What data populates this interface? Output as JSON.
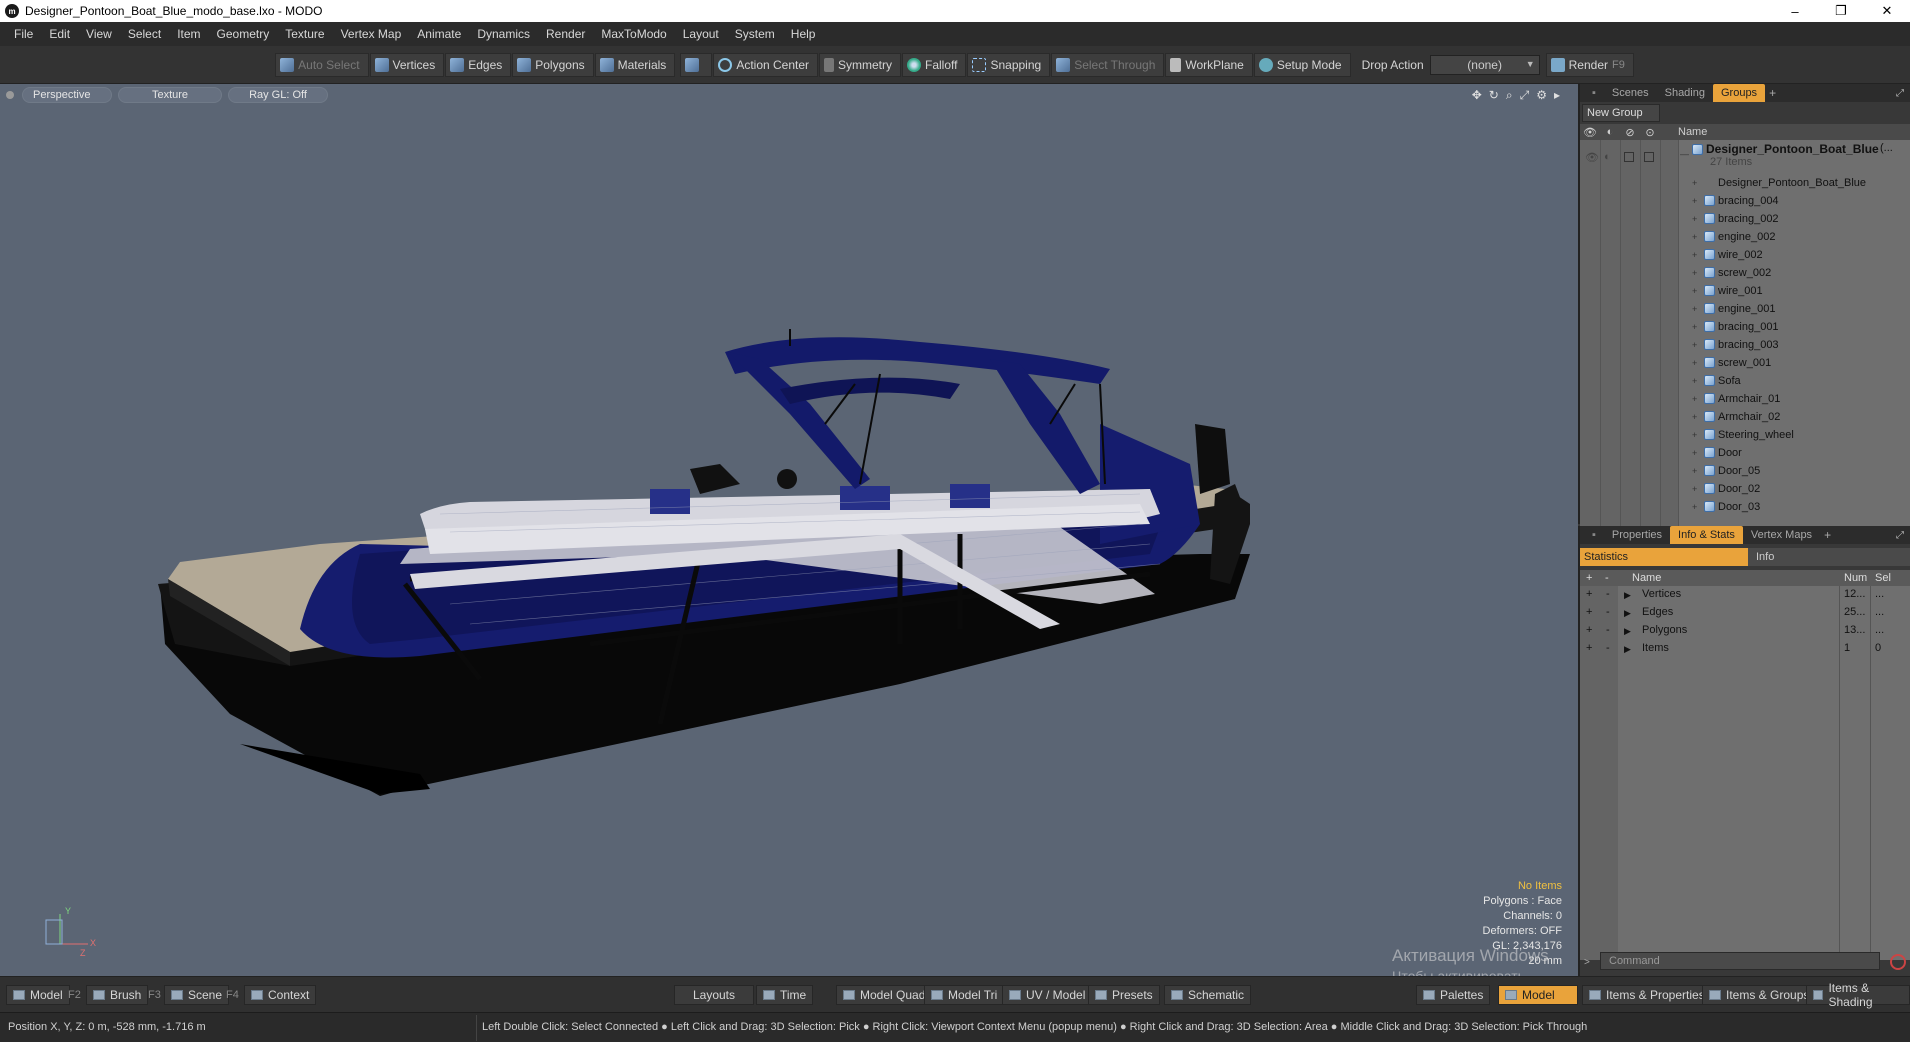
{
  "window": {
    "title": "Designer_Pontoon_Boat_Blue_modo_base.lxo - MODO",
    "controls": [
      "–",
      "❐",
      "✕"
    ]
  },
  "menu": [
    "File",
    "Edit",
    "View",
    "Select",
    "Item",
    "Geometry",
    "Texture",
    "Vertex Map",
    "Animate",
    "Dynamics",
    "Render",
    "MaxToModo",
    "Layout",
    "System",
    "Help"
  ],
  "toolbar": {
    "auto_select": "Auto Select",
    "vertices": "Vertices",
    "edges": "Edges",
    "polygons": "Polygons",
    "materials": "Materials",
    "action_center": "Action Center",
    "symmetry": "Symmetry",
    "falloff": "Falloff",
    "snapping": "Snapping",
    "select_through": "Select Through",
    "workplane": "WorkPlane",
    "setup_mode": "Setup Mode",
    "drop_action_label": "Drop Action",
    "drop_action_value": "(none)",
    "render": "Render",
    "render_key": "F9"
  },
  "viewport": {
    "tabs": [
      "Perspective",
      "Texture",
      "Ray GL: Off"
    ],
    "nav_icons": [
      "move-icon",
      "rotate-icon",
      "zoom-icon",
      "maximize-icon",
      "settings-icon",
      "play-icon"
    ],
    "stats": {
      "no_items": "No Items",
      "polygons": "Polygons : Face",
      "channels": "Channels: 0",
      "deformers": "Deformers: OFF",
      "gl": "GL: 2,343,176",
      "scale": "20 mm"
    },
    "axis": {
      "y": "Y",
      "x": "X",
      "z": "Z"
    },
    "watermark_line1": "Активация Windows",
    "watermark_line2": "Чтобы активировать Windows, перейдите в раздел \"Параметры\"."
  },
  "groups_panel": {
    "tabs": [
      "Scenes",
      "Shading",
      "Groups"
    ],
    "active_tab": "Groups",
    "new_group": "New Group",
    "name_header": "Name",
    "root": {
      "name": "Designer_Pontoon_Boat_Blue",
      "suffix": "(...",
      "count": "27 Items"
    },
    "items": [
      "Designer_Pontoon_Boat_Blue",
      "bracing_004",
      "bracing_002",
      "engine_002",
      "wire_002",
      "screw_002",
      "wire_001",
      "engine_001",
      "bracing_001",
      "bracing_003",
      "screw_001",
      "Sofa",
      "Armchair_01",
      "Armchair_02",
      "Steering_wheel",
      "Door",
      "Door_05",
      "Door_02",
      "Door_03"
    ]
  },
  "stats_panel": {
    "tabs": [
      "Properties",
      "Info & Stats",
      "Vertex Maps"
    ],
    "active_tab": "Info & Stats",
    "statistics": "Statistics",
    "info": "Info",
    "headers": {
      "name": "Name",
      "num": "Num",
      "sel": "Sel"
    },
    "rows": [
      {
        "name": "Vertices",
        "num": "12...",
        "sel": "..."
      },
      {
        "name": "Edges",
        "num": "25...",
        "sel": "..."
      },
      {
        "name": "Polygons",
        "num": "13...",
        "sel": "..."
      },
      {
        "name": "Items",
        "num": "1",
        "sel": "0"
      }
    ],
    "command_placeholder": "Command"
  },
  "bottombar": {
    "model": "Model",
    "model_key": "F2",
    "brush": "Brush",
    "brush_key": "F3",
    "scene": "Scene",
    "scene_key": "F4",
    "context": "Context",
    "layouts": "Layouts",
    "time": "Time",
    "model_quad": "Model Quad",
    "model_tri": "Model Tri",
    "uv_model": "UV / Model",
    "presets": "Presets",
    "schematic": "Schematic",
    "palettes": "Palettes",
    "model_active": "Model",
    "items_properties": "Items & Properties",
    "items_groups": "Items & Groups",
    "items_shading": "Items & Shading"
  },
  "statusbar": {
    "position": "Position X, Y, Z:   0 m, -528 mm, -1.716 m",
    "hints": "Left Double Click: Select Connected ● Left Click and Drag: 3D Selection: Pick ● Right Click: Viewport Context Menu (popup menu) ● Right Click and Drag: 3D Selection: Area ● Middle Click and Drag: 3D Selection: Pick Through"
  },
  "colors": {
    "accent": "#e9a33b",
    "viewport_bg": "#5b6574",
    "boat_blue": "#141a6e",
    "hull_black": "#0a0a0a",
    "deck": "#b7ad9a"
  }
}
